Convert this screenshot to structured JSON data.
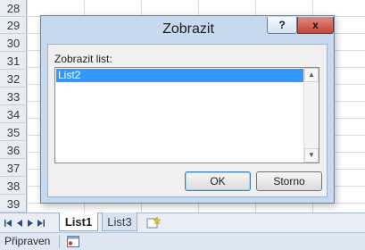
{
  "grid": {
    "row_numbers": [
      "28",
      "29",
      "30",
      "31",
      "32",
      "33",
      "34",
      "35",
      "36",
      "37",
      "38",
      "39"
    ]
  },
  "sheet_tabs": {
    "tabs": [
      {
        "label": "List1",
        "active": true
      },
      {
        "label": "List3",
        "active": false
      }
    ]
  },
  "status_bar": {
    "status": "Připraven",
    "macro_icon": "macro-record-icon"
  },
  "dialog": {
    "title": "Zobrazit",
    "help_label": "?",
    "close_label": "x",
    "list_label": "Zobrazit list:",
    "items": [
      "List2"
    ],
    "selected_index": 0,
    "ok_label": "OK",
    "cancel_label": "Storno"
  },
  "colors": {
    "dialog_frame": "#c7d9ee",
    "selection": "#3399ff",
    "close_button": "#c8473a"
  }
}
